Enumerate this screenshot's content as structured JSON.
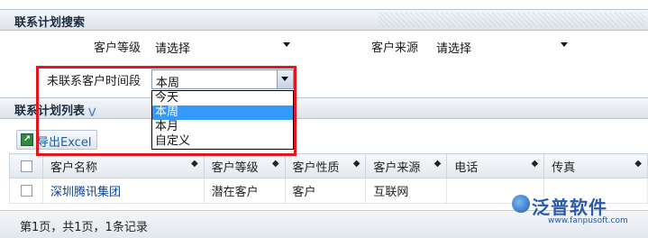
{
  "search_panel": {
    "title": "联系计划搜索"
  },
  "form": {
    "customer_level_label": "客户等级",
    "customer_level_value": "请选择",
    "customer_source_label": "客户来源",
    "customer_source_value": "请选择",
    "uncontacted_period_label": "未联系客户时间段",
    "uncontacted_period_value": "本周"
  },
  "period_dropdown": {
    "options": [
      "今天",
      "本周",
      "本月",
      "自定义"
    ],
    "selected": "本周"
  },
  "list_panel": {
    "title": "联系计划列表",
    "export_label": "导出Excel"
  },
  "table": {
    "columns": [
      "客户名称",
      "客户等级",
      "客户性质",
      "客户来源",
      "电话",
      "传真"
    ],
    "rows": [
      {
        "customer_name": "深圳腾讯集团",
        "level": "潜在客户",
        "nature": "客户",
        "source": "互联网",
        "phone": "",
        "fax": ""
      }
    ]
  },
  "footer": {
    "pagination": "第1页，共1页，1条记录"
  },
  "watermark": {
    "name": "泛普软件",
    "url": "www.fanpusoft.com"
  },
  "colors": {
    "highlight_box": "#e4161d",
    "selected_option": "#3399ff",
    "link": "#0b3f91"
  }
}
